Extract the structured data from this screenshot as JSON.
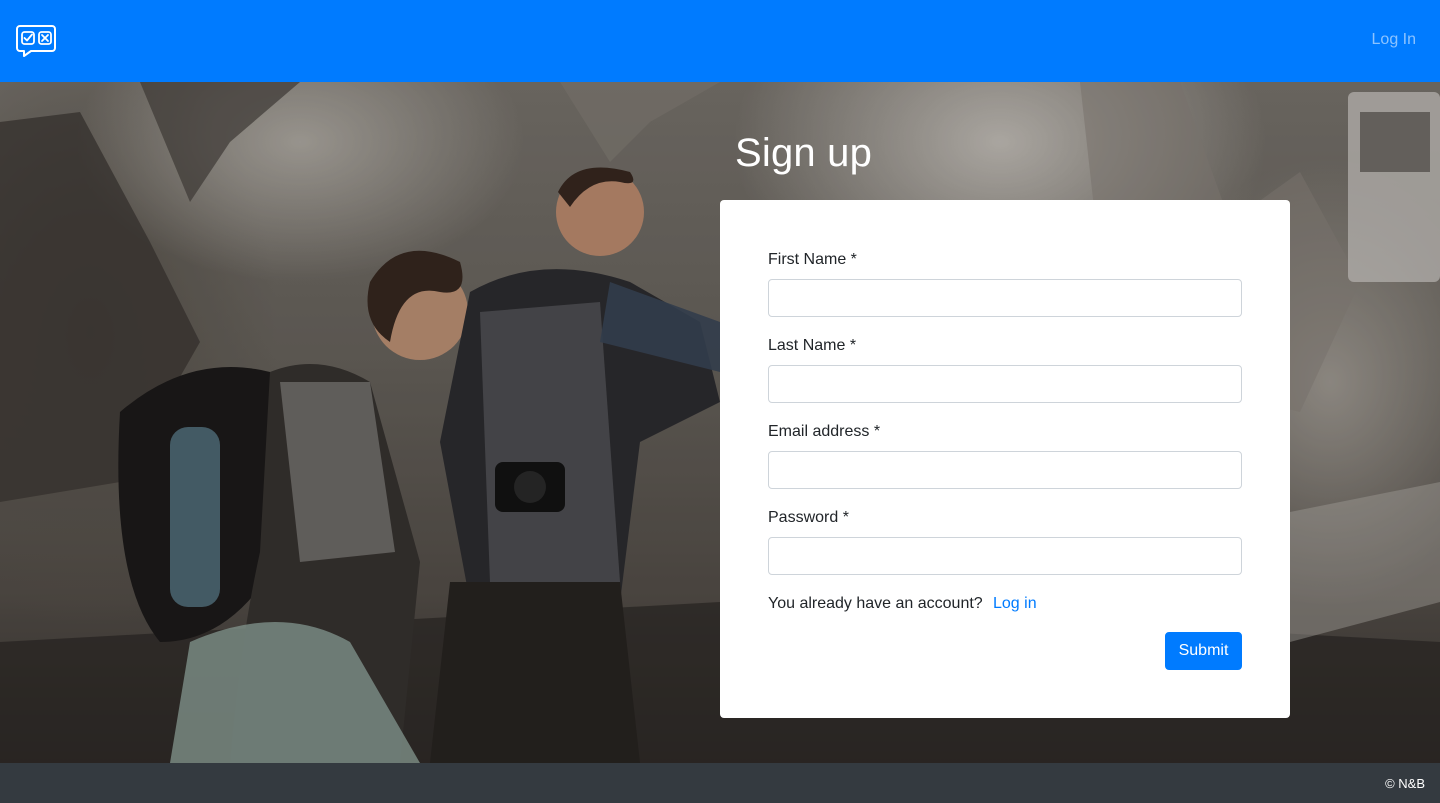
{
  "navbar": {
    "brand_icon": "chat-check-x-icon",
    "login_label": "Log In",
    "background_color": "#007bff"
  },
  "page": {
    "title": "Sign up"
  },
  "form": {
    "fields": [
      {
        "label": "First Name *",
        "value": "",
        "type": "text"
      },
      {
        "label": "Last Name *",
        "value": "",
        "type": "text"
      },
      {
        "label": "Email address *",
        "value": "",
        "type": "email"
      },
      {
        "label": "Password *",
        "value": "",
        "type": "password"
      }
    ],
    "account_prompt": "You already have an account?",
    "login_link": "Log in",
    "submit_label": "Submit",
    "accent_color": "#007bff"
  },
  "footer": {
    "copyright": "© N&B",
    "background_color": "#343a40"
  }
}
